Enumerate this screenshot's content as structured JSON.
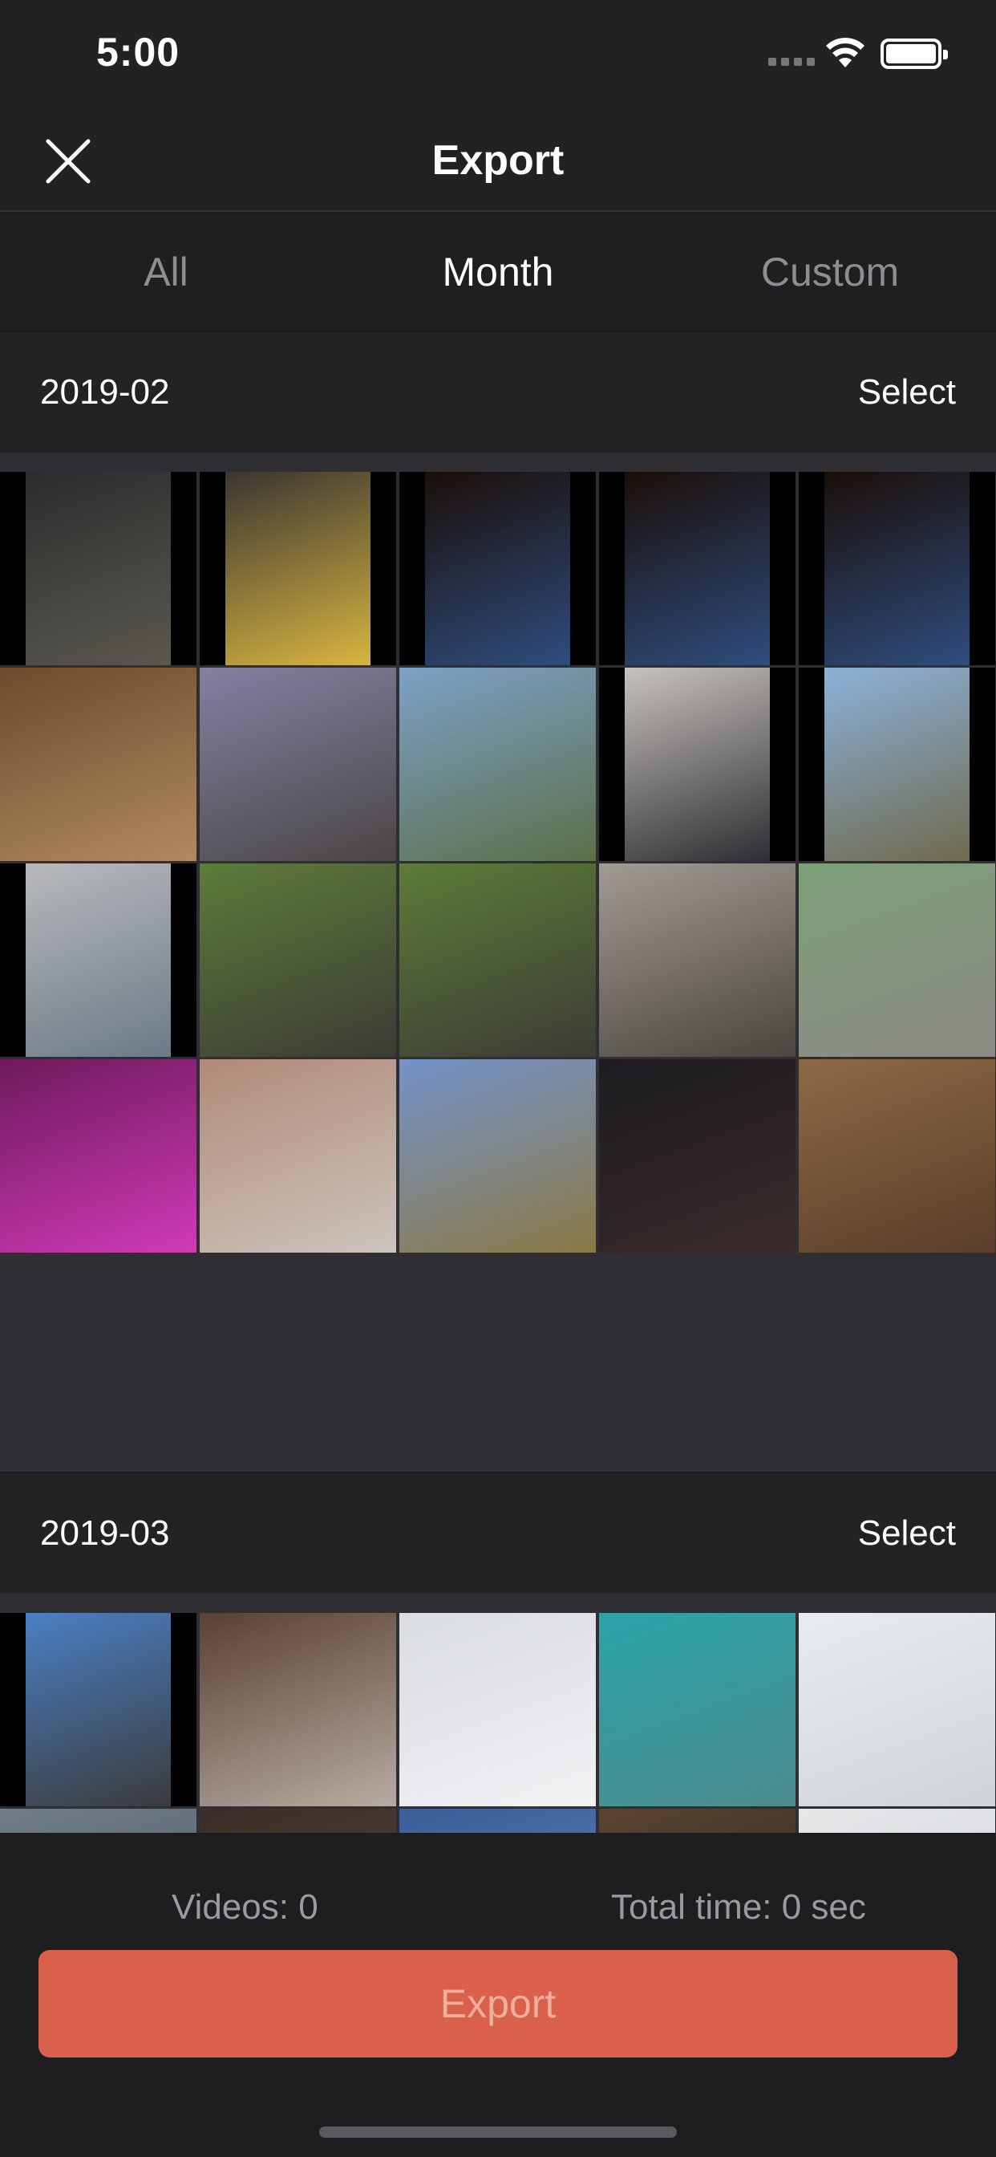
{
  "status_bar": {
    "time": "5:00",
    "wifi_icon": "wifi-icon",
    "battery_icon": "battery-icon"
  },
  "nav": {
    "title": "Export",
    "close_icon": "close-icon"
  },
  "tabs": [
    {
      "label": "All",
      "active": false
    },
    {
      "label": "Month",
      "active": true
    },
    {
      "label": "Custom",
      "active": false
    }
  ],
  "sections": [
    {
      "date": "2019-02",
      "select_label": "Select",
      "thumbnails": [
        {
          "subject": "snail on gravel",
          "colors": [
            "#2c2c2c",
            "#5b5850"
          ],
          "orientation": "portrait"
        },
        {
          "subject": "man in yellow shirt",
          "colors": [
            "#3a3630",
            "#d8b540"
          ],
          "orientation": "portrait"
        },
        {
          "subject": "star wars arcade",
          "colors": [
            "#1a0f08",
            "#2f4c7d"
          ],
          "orientation": "portrait"
        },
        {
          "subject": "star wars arcade",
          "colors": [
            "#1a0f08",
            "#2f4c7d"
          ],
          "orientation": "portrait"
        },
        {
          "subject": "star wars arcade",
          "colors": [
            "#1a0f08",
            "#2f4c7d"
          ],
          "orientation": "portrait"
        },
        {
          "subject": "laptop on desk",
          "colors": [
            "#6e4a2c",
            "#b08a63"
          ],
          "orientation": "landscape"
        },
        {
          "subject": "VR room",
          "colors": [
            "#8580a2",
            "#4a4644"
          ],
          "orientation": "landscape"
        },
        {
          "subject": "woman at cliff",
          "colors": [
            "#7ea1c6",
            "#5b6f49"
          ],
          "orientation": "landscape"
        },
        {
          "subject": "man in cap",
          "colors": [
            "#c7c2bd",
            "#2e2e33"
          ],
          "orientation": "portrait"
        },
        {
          "subject": "church",
          "colors": [
            "#8db1d8",
            "#6f6a4e"
          ],
          "orientation": "portrait"
        },
        {
          "subject": "man portrait",
          "colors": [
            "#b8b9bb",
            "#6c7b88"
          ],
          "orientation": "portrait"
        },
        {
          "subject": "friends in garden",
          "colors": [
            "#5d7c3a",
            "#3c3b35"
          ],
          "orientation": "landscape"
        },
        {
          "subject": "friends in garden",
          "colors": [
            "#5d7c3a",
            "#3c3b35"
          ],
          "orientation": "landscape"
        },
        {
          "subject": "dancing indoors",
          "colors": [
            "#a29b92",
            "#4a4540"
          ],
          "orientation": "landscape"
        },
        {
          "subject": "elephant",
          "colors": [
            "#7ea07a",
            "#8e8a86"
          ],
          "orientation": "landscape"
        },
        {
          "subject": "pink lights",
          "colors": [
            "#6d1a5c",
            "#d03ab6"
          ],
          "orientation": "landscape"
        },
        {
          "subject": "two women posing",
          "colors": [
            "#b08a79",
            "#ccc4bc"
          ],
          "orientation": "landscape"
        },
        {
          "subject": "festival field",
          "colors": [
            "#7593c9",
            "#8a7a45"
          ],
          "orientation": "landscape"
        },
        {
          "subject": "neon boats",
          "colors": [
            "#1c1c20",
            "#3a2a2a"
          ],
          "orientation": "landscape"
        },
        {
          "subject": "wardrobe room",
          "colors": [
            "#8d6a46",
            "#5a3d2a"
          ],
          "orientation": "landscape"
        }
      ]
    },
    {
      "date": "2019-03",
      "select_label": "Select",
      "thumbnails": [
        {
          "subject": "friends by container",
          "colors": [
            "#4b7fc2",
            "#3b3b3b"
          ],
          "orientation": "portrait"
        },
        {
          "subject": "korean bbq grill",
          "colors": [
            "#5a4034",
            "#b7aca2"
          ],
          "orientation": "landscape"
        },
        {
          "subject": "skier on slope",
          "colors": [
            "#d8dbe0",
            "#f1f2f4"
          ],
          "orientation": "landscape"
        },
        {
          "subject": "underwater selfie",
          "colors": [
            "#2aa3a8",
            "#4e8c8e"
          ],
          "orientation": "landscape"
        },
        {
          "subject": "ski slope",
          "colors": [
            "#e9ecef",
            "#cfd3d8"
          ],
          "orientation": "landscape"
        },
        {
          "subject": "partial row",
          "colors": [
            "#6e7d88",
            "#4b5a66"
          ],
          "orientation": "landscape"
        },
        {
          "subject": "partial row",
          "colors": [
            "#3a2e26",
            "#5b4a3c"
          ],
          "orientation": "landscape"
        },
        {
          "subject": "partial row",
          "colors": [
            "#3a5e9a",
            "#5f85c2"
          ],
          "orientation": "landscape"
        },
        {
          "subject": "partial row",
          "colors": [
            "#5a4430",
            "#2a2220"
          ],
          "orientation": "landscape"
        },
        {
          "subject": "partial row",
          "colors": [
            "#e6e8ea",
            "#cfd3d8"
          ],
          "orientation": "landscape"
        }
      ]
    }
  ],
  "footer": {
    "videos_label": "Videos: 0",
    "total_time_label": "Total time: 0 sec",
    "export_button": "Export",
    "accent_color": "#d9604a"
  }
}
